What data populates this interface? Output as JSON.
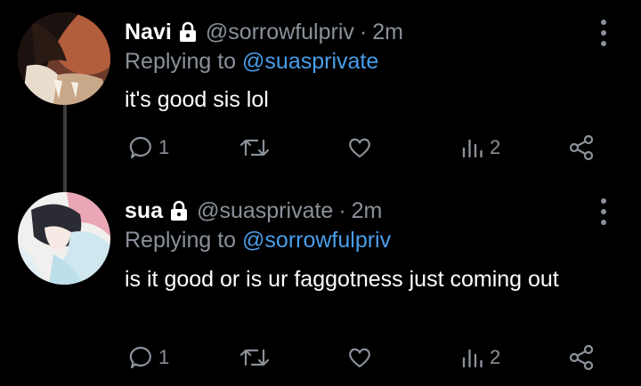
{
  "colors": {
    "background": "#000000",
    "text": "#ffffff",
    "muted": "#8a9199",
    "link": "#4a9ee8"
  },
  "tweets": [
    {
      "name": "Navi",
      "handle": "@sorrowfulpriv",
      "separator": "·",
      "time": "2m",
      "replying_prefix": "Replying to ",
      "replying_to": "@suasprivate",
      "text": "it's good sis lol",
      "reply_count": "1",
      "views_count": "2",
      "icons": [
        "lock-icon",
        "reply-icon",
        "retweet-icon",
        "like-icon",
        "views-icon",
        "share-icon",
        "more-icon"
      ]
    },
    {
      "name": "sua",
      "handle": "@suasprivate",
      "separator": "·",
      "time": "2m",
      "replying_prefix": "Replying to ",
      "replying_to": "@sorrowfulpriv",
      "text": "is it good or is ur faggotness just coming out",
      "reply_count": "1",
      "views_count": "2",
      "icons": [
        "lock-icon",
        "reply-icon",
        "retweet-icon",
        "like-icon",
        "views-icon",
        "share-icon",
        "more-icon"
      ]
    }
  ]
}
